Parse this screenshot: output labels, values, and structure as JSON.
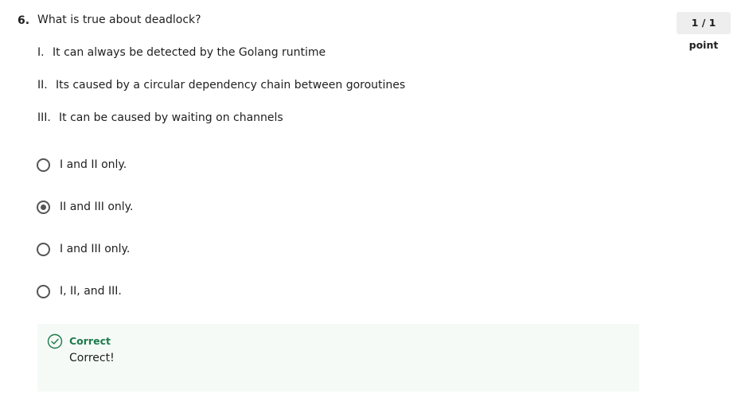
{
  "question": {
    "number": "6.",
    "text": "What is true about deadlock?",
    "points": "1 / 1 point",
    "statements": [
      {
        "numeral": "I.",
        "text": "It can always be detected by the Golang runtime"
      },
      {
        "numeral": "II.",
        "text": "Its caused by a circular dependency chain between goroutines"
      },
      {
        "numeral": "III.",
        "text": "It can be caused by waiting on channels"
      }
    ],
    "options": [
      {
        "label": "I and II only.",
        "selected": false
      },
      {
        "label": "II and III only.",
        "selected": true
      },
      {
        "label": "I and III only.",
        "selected": false
      },
      {
        "label": "I, II, and III.",
        "selected": false
      }
    ]
  },
  "feedback": {
    "status": "Correct",
    "message": "Correct!",
    "accent_color": "#1e7a4b",
    "background_color": "#f5faf7",
    "icon": "check-circle-icon"
  }
}
